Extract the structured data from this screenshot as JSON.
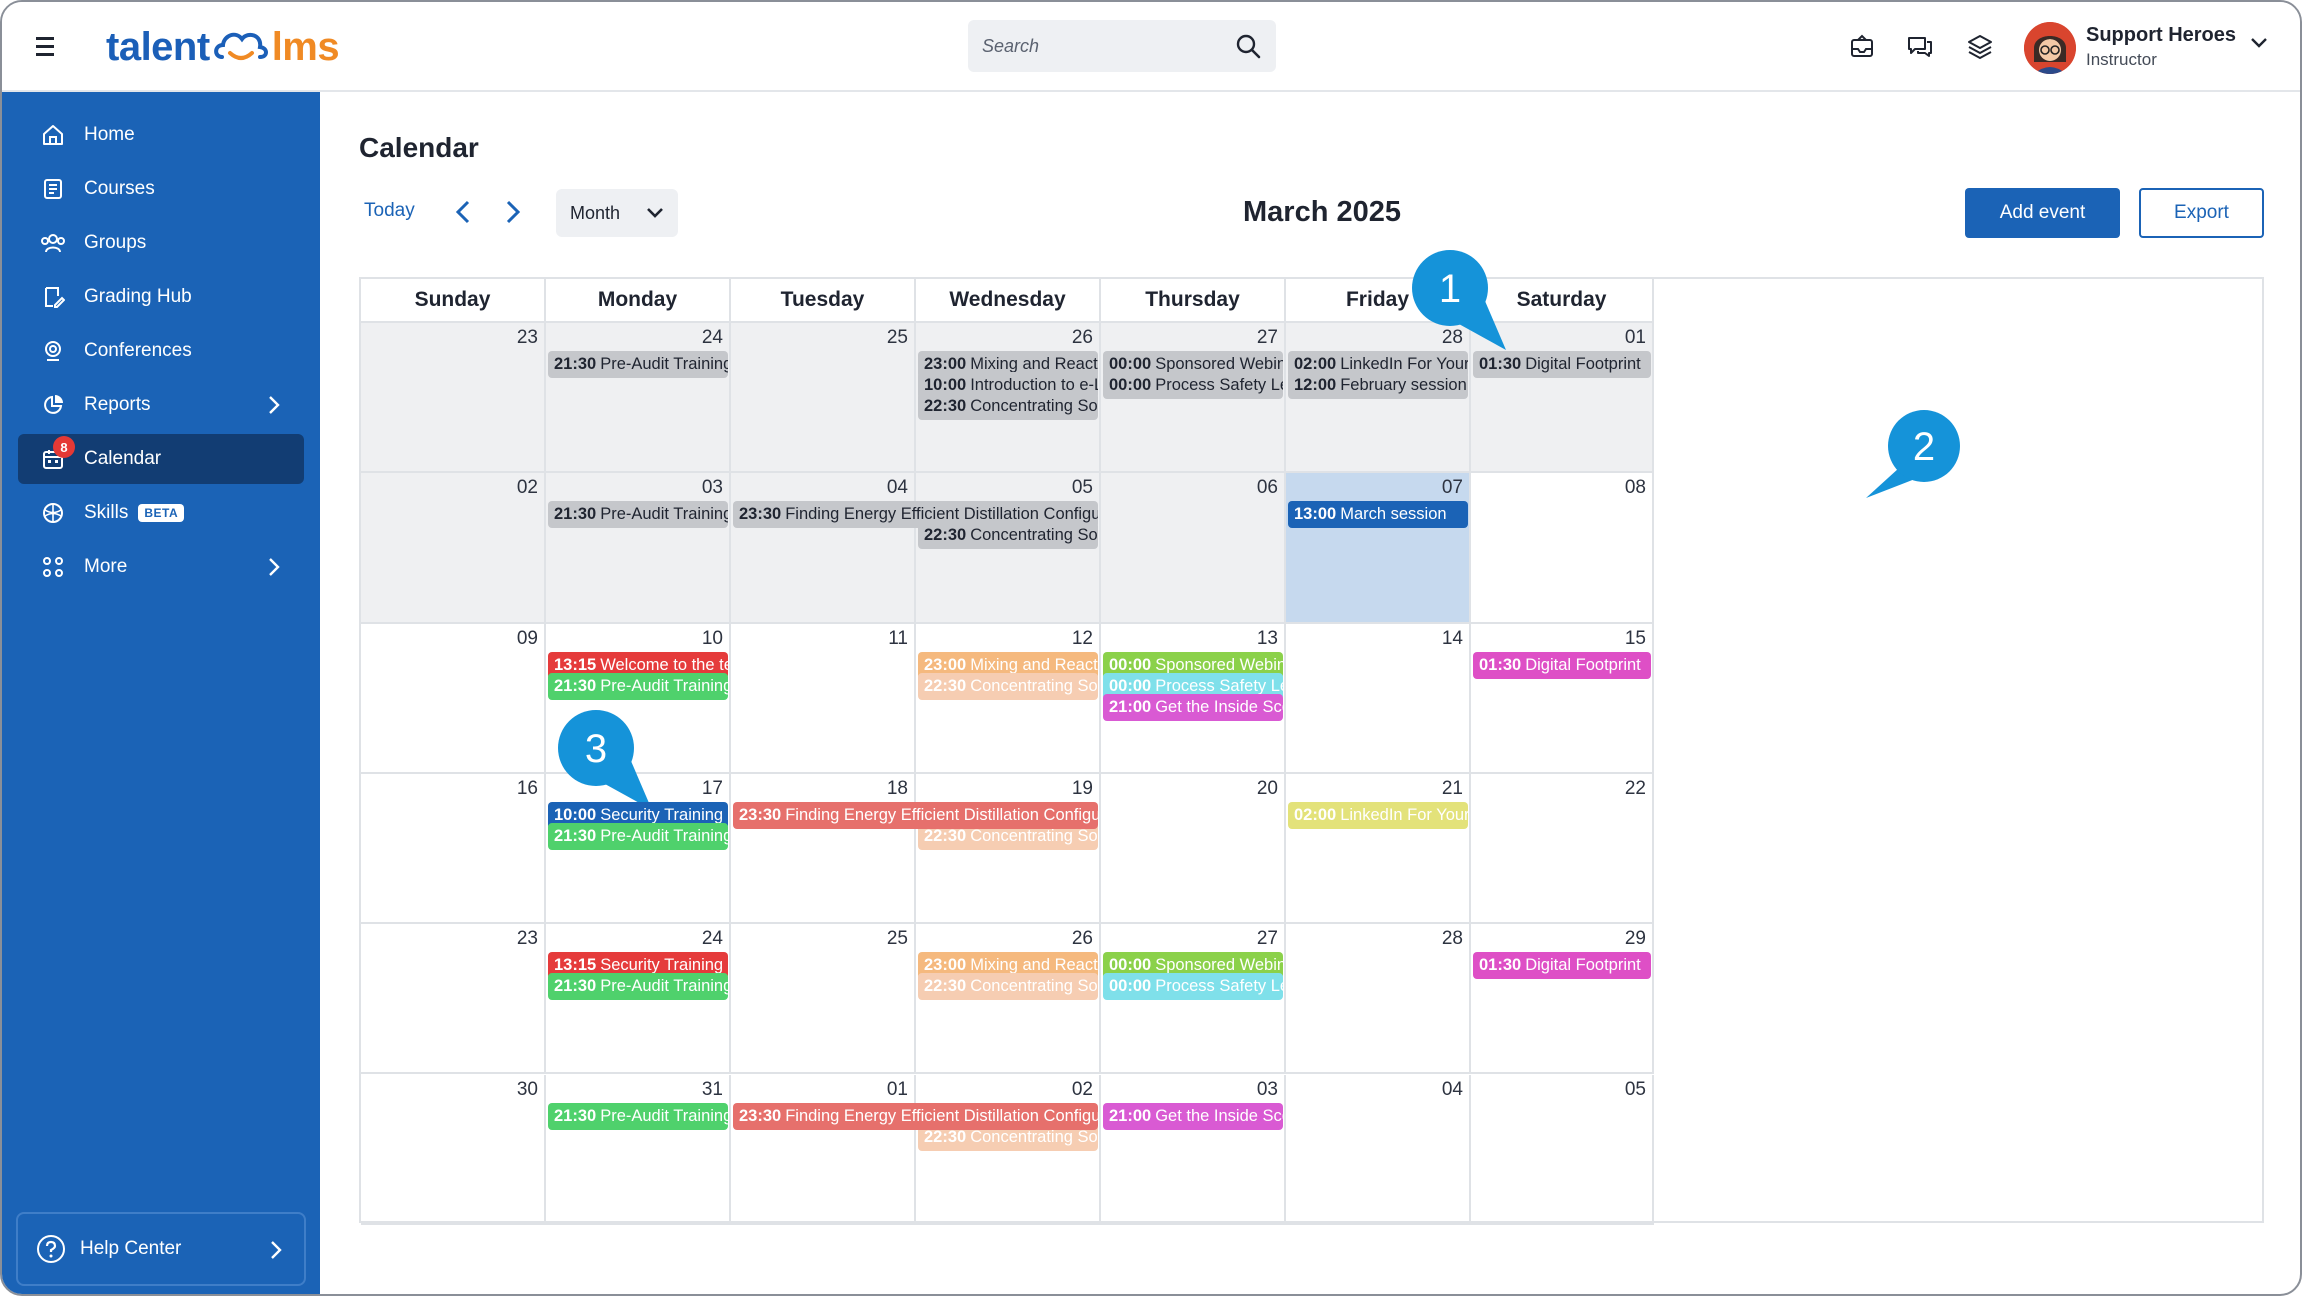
{
  "app": {
    "logo_left": "talent",
    "logo_right": "lms"
  },
  "search": {
    "placeholder": "Search"
  },
  "user": {
    "name": "Support Heroes",
    "role": "Instructor"
  },
  "sidebar": {
    "items": [
      {
        "label": "Home",
        "icon": "home-icon"
      },
      {
        "label": "Courses",
        "icon": "courses-icon"
      },
      {
        "label": "Groups",
        "icon": "groups-icon"
      },
      {
        "label": "Grading Hub",
        "icon": "grading-icon"
      },
      {
        "label": "Conferences",
        "icon": "conferences-icon"
      },
      {
        "label": "Reports",
        "icon": "reports-icon"
      },
      {
        "label": "Calendar",
        "icon": "calendar-icon",
        "badge": "8"
      },
      {
        "label": "Skills",
        "icon": "skills-icon",
        "tag": "BETA"
      },
      {
        "label": "More",
        "icon": "more-icon"
      }
    ],
    "help": "Help Center"
  },
  "main": {
    "title": "Calendar",
    "today_label": "Today",
    "view_select": "Month",
    "month_title": "March 2025",
    "add_event": "Add event",
    "export": "Export"
  },
  "calendar": {
    "weekdays": [
      "Sunday",
      "Monday",
      "Tuesday",
      "Wednesday",
      "Thursday",
      "Friday",
      "Saturday"
    ],
    "weeks": [
      [
        {
          "day": "23",
          "state": "past",
          "events": []
        },
        {
          "day": "24",
          "state": "past",
          "events": [
            {
              "time": "21:30",
              "title": "Pre-Audit Training",
              "color": "#c5c7cb",
              "text": "#1f2430"
            }
          ]
        },
        {
          "day": "25",
          "state": "past",
          "events": []
        },
        {
          "day": "26",
          "state": "past",
          "events": [
            {
              "time": "23:00",
              "title": "Mixing and Reaction without",
              "color": "#c5c7cb",
              "text": "#1f2430"
            },
            {
              "time": "10:00",
              "title": "Introduction to e-Learning",
              "color": "#c5c7cb",
              "text": "#1f2430"
            },
            {
              "time": "22:30",
              "title": "Concentrating Solar Power: S",
              "color": "#c5c7cb",
              "text": "#1f2430"
            }
          ]
        },
        {
          "day": "27",
          "state": "past",
          "events": [
            {
              "time": "00:00",
              "title": "Sponsored Webinar: Essentia",
              "color": "#c5c7cb",
              "text": "#1f2430"
            },
            {
              "time": "00:00",
              "title": "Process Safety Leadership an",
              "color": "#c5c7cb",
              "text": "#1f2430"
            }
          ]
        },
        {
          "day": "28",
          "state": "past",
          "events": [
            {
              "time": "02:00",
              "title": "LinkedIn For Your Business",
              "color": "#c5c7cb",
              "text": "#1f2430"
            },
            {
              "time": "12:00",
              "title": "February session",
              "color": "#c5c7cb",
              "text": "#1f2430"
            }
          ]
        },
        {
          "day": "01",
          "state": "past",
          "events": [
            {
              "time": "01:30",
              "title": "Digital Footprint",
              "color": "#c5c7cb",
              "text": "#1f2430"
            }
          ]
        }
      ],
      [
        {
          "day": "02",
          "state": "past",
          "events": []
        },
        {
          "day": "03",
          "state": "past",
          "events": [
            {
              "time": "21:30",
              "title": "Pre-Audit Training",
              "color": "#c5c7cb",
              "text": "#1f2430"
            }
          ]
        },
        {
          "day": "04",
          "state": "past",
          "events": [
            {
              "time": "23:30",
              "title": "Finding Energy Efficient Distillation Configurations and Dividing Wa",
              "color": "#c5c7cb",
              "text": "#1f2430",
              "span": 2
            }
          ]
        },
        {
          "day": "05",
          "state": "past",
          "events": [
            {
              "time": "",
              "title": "",
              "spacer": true
            },
            {
              "time": "22:30",
              "title": "Concentrating Solar Power: S",
              "color": "#c5c7cb",
              "text": "#1f2430"
            }
          ]
        },
        {
          "day": "06",
          "state": "past",
          "events": []
        },
        {
          "day": "07",
          "state": "today",
          "events": [
            {
              "time": "13:00",
              "title": "March session",
              "color": "#1b63b6",
              "text": "#ffffff"
            }
          ]
        },
        {
          "day": "08",
          "state": "",
          "events": []
        }
      ],
      [
        {
          "day": "09",
          "state": "",
          "events": []
        },
        {
          "day": "10",
          "state": "",
          "events": [
            {
              "time": "13:15",
              "title": "Welcome to the team!",
              "color": "#e53b3b",
              "text": "#ffffff"
            },
            {
              "time": "21:30",
              "title": "Pre-Audit Training",
              "color": "#4fd16c",
              "text": "#ffffff"
            }
          ]
        },
        {
          "day": "11",
          "state": "",
          "events": []
        },
        {
          "day": "12",
          "state": "",
          "events": [
            {
              "time": "23:00",
              "title": "Mixing and Reaction without",
              "color": "#f5b97e",
              "text": "#ffffff"
            },
            {
              "time": "22:30",
              "title": "Concentrating Solar Power: S",
              "color": "#f6cdb2",
              "text": "#ffffff"
            }
          ]
        },
        {
          "day": "13",
          "state": "",
          "events": [
            {
              "time": "00:00",
              "title": "Sponsored Webinar: Essentia",
              "color": "#8bd14a",
              "text": "#ffffff"
            },
            {
              "time": "00:00",
              "title": "Process Safety Leadership an",
              "color": "#7fe0ea",
              "text": "#ffffff"
            },
            {
              "time": "21:00",
              "title": "Get the Inside Scoop on Goog",
              "color": "#d95ad3",
              "text": "#ffffff"
            }
          ]
        },
        {
          "day": "14",
          "state": "",
          "events": []
        },
        {
          "day": "15",
          "state": "",
          "events": [
            {
              "time": "01:30",
              "title": "Digital Footprint",
              "color": "#de4fc6",
              "text": "#ffffff"
            }
          ]
        }
      ],
      [
        {
          "day": "16",
          "state": "",
          "events": []
        },
        {
          "day": "17",
          "state": "",
          "events": [
            {
              "time": "10:00",
              "title": "Security Training",
              "color": "#1b63b6",
              "text": "#ffffff"
            },
            {
              "time": "21:30",
              "title": "Pre-Audit Training",
              "color": "#4fd16c",
              "text": "#ffffff"
            }
          ]
        },
        {
          "day": "18",
          "state": "",
          "events": [
            {
              "time": "23:30",
              "title": "Finding Energy Efficient Distillation Configurations and Dividing Wa",
              "color": "#e6706c",
              "text": "#ffffff",
              "span": 2
            }
          ]
        },
        {
          "day": "19",
          "state": "",
          "events": [
            {
              "time": "",
              "title": "",
              "spacer": true
            },
            {
              "time": "22:30",
              "title": "Concentrating Solar Power: S",
              "color": "#f6cdb2",
              "text": "#ffffff"
            }
          ]
        },
        {
          "day": "20",
          "state": "",
          "events": []
        },
        {
          "day": "21",
          "state": "",
          "events": [
            {
              "time": "02:00",
              "title": "LinkedIn For Your Business",
              "color": "#e3e27a",
              "text": "#ffffff"
            }
          ]
        },
        {
          "day": "22",
          "state": "",
          "events": []
        }
      ],
      [
        {
          "day": "23",
          "state": "",
          "events": []
        },
        {
          "day": "24",
          "state": "",
          "events": [
            {
              "time": "13:15",
              "title": "Security Training Session",
              "color": "#e53b3b",
              "text": "#ffffff"
            },
            {
              "time": "21:30",
              "title": "Pre-Audit Training",
              "color": "#4fd16c",
              "text": "#ffffff"
            }
          ]
        },
        {
          "day": "25",
          "state": "",
          "events": []
        },
        {
          "day": "26",
          "state": "",
          "events": [
            {
              "time": "23:00",
              "title": "Mixing and Reaction without",
              "color": "#f5b97e",
              "text": "#ffffff"
            },
            {
              "time": "22:30",
              "title": "Concentrating Solar Power: S",
              "color": "#f6cdb2",
              "text": "#ffffff"
            }
          ]
        },
        {
          "day": "27",
          "state": "",
          "events": [
            {
              "time": "00:00",
              "title": "Sponsored Webinar: Essentia",
              "color": "#8bd14a",
              "text": "#ffffff"
            },
            {
              "time": "00:00",
              "title": "Process Safety Leadership an",
              "color": "#7fe0ea",
              "text": "#ffffff"
            }
          ]
        },
        {
          "day": "28",
          "state": "",
          "events": []
        },
        {
          "day": "29",
          "state": "",
          "events": [
            {
              "time": "01:30",
              "title": "Digital Footprint",
              "color": "#de4fc6",
              "text": "#ffffff"
            }
          ]
        }
      ],
      [
        {
          "day": "30",
          "state": "",
          "events": []
        },
        {
          "day": "31",
          "state": "",
          "events": [
            {
              "time": "21:30",
              "title": "Pre-Audit Training",
              "color": "#4fd16c",
              "text": "#ffffff"
            }
          ]
        },
        {
          "day": "01",
          "state": "",
          "events": [
            {
              "time": "23:30",
              "title": "Finding Energy Efficient Distillation Configurations and Dividing Wa",
              "color": "#e6706c",
              "text": "#ffffff",
              "span": 2
            }
          ]
        },
        {
          "day": "02",
          "state": "",
          "events": [
            {
              "time": "",
              "title": "",
              "spacer": true
            },
            {
              "time": "22:30",
              "title": "Concentrating Solar Power: S",
              "color": "#f6cdb2",
              "text": "#ffffff"
            }
          ]
        },
        {
          "day": "03",
          "state": "",
          "events": [
            {
              "time": "21:00",
              "title": "Get the Inside Scoop on Goog",
              "color": "#d95ad3",
              "text": "#ffffff"
            }
          ]
        },
        {
          "day": "04",
          "state": "",
          "events": []
        },
        {
          "day": "05",
          "state": "",
          "events": []
        }
      ]
    ]
  },
  "callouts": [
    "1",
    "2",
    "3"
  ],
  "colors": {
    "brand": "#1b63b6",
    "sidebar_active": "#123d73",
    "today_cell": "#c6d9ee"
  }
}
